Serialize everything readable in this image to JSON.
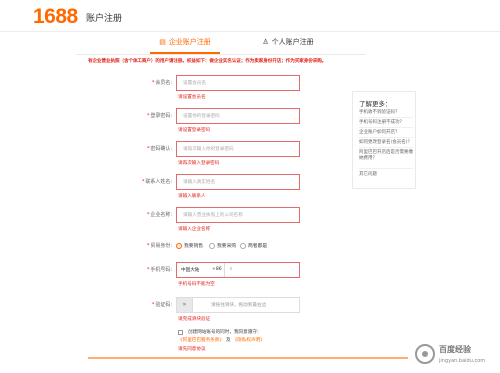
{
  "header": {
    "logo": "1688",
    "title": "账户注册"
  },
  "tabs": [
    {
      "label": "企业账户注册",
      "icon": "building-icon",
      "active": true
    },
    {
      "label": "个人账户注册",
      "icon": "person-icon",
      "active": false
    }
  ],
  "notice": {
    "part1": "有企业营业执照（含个体工商户）的用户请注册。权益如下：",
    "part2": "做企业实名认证；作为卖家身份开店；作为买家身份采购。"
  },
  "form": {
    "member_name": {
      "label": "会员名:",
      "placeholder": "设置会员名",
      "error": "请设置会员名"
    },
    "password": {
      "label": "登录密码:",
      "placeholder": "设置你的登录密码",
      "error": "请设置登录密码"
    },
    "password_confirm": {
      "label": "密码确认:",
      "placeholder": "请再次输入你的登录密码",
      "error": "请再次输入登录密码"
    },
    "contact_name": {
      "label": "联系人姓名:",
      "placeholder": "请输入真实姓名",
      "error": "请输入联系人"
    },
    "company_name": {
      "label": "企业名称:",
      "placeholder": "请输入营业执照上的公司名称",
      "error": "请输入企业名称"
    },
    "business_identity": {
      "label": "贸易身份:",
      "options": [
        "我要销售",
        "我要采购",
        "两者都是"
      ],
      "selected": "我要销售"
    },
    "phone": {
      "label": "手机号码:",
      "country": "中国大陆",
      "code": "+86",
      "error": "手机号码不能为空"
    },
    "captcha": {
      "label": "验证码:",
      "text": "请按住滑块，拖动到最右边",
      "handle": "»",
      "error": "请完成滑块验证"
    },
    "agreement": {
      "text": "创建网站账号的同时，我同意遵守：",
      "link1": "《阿里巴巴服务条款》",
      "and": "及",
      "link2": "《隐私权声明》",
      "error": "请先同意协议"
    }
  },
  "sidebar": {
    "title": "了解更多：",
    "items": [
      "手机收不到验证码？",
      "手机号码注册不成功？",
      "企业账户如何开店？",
      "如何更改登录名(会员名)？",
      "阿里巴巴开店后是否需要缴纳费用？",
      "其它问题"
    ]
  },
  "watermark": {
    "text": "百度经验",
    "sub": "jingyan.baidu.com"
  },
  "colors": {
    "accent": "#ff6a00",
    "error": "#e0251c"
  }
}
